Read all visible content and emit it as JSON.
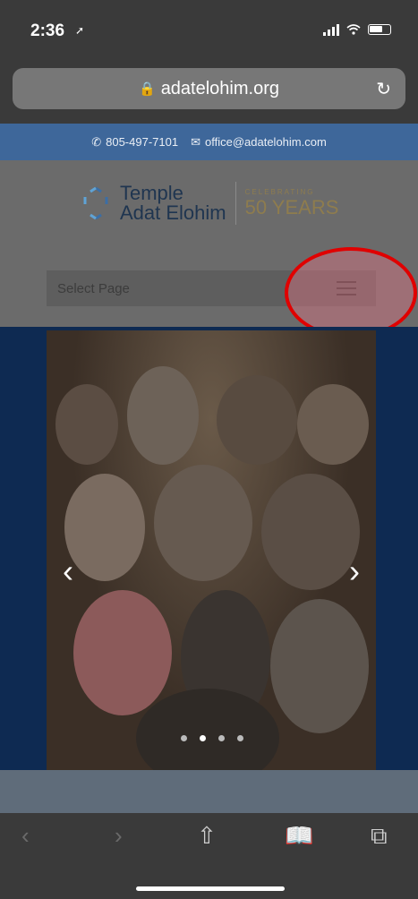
{
  "status": {
    "time": "2:36"
  },
  "browser": {
    "url": "adatelohim.org"
  },
  "contact": {
    "phone": "805-497-7101",
    "email": "office@adatelohim.com"
  },
  "logo": {
    "line1": "Temple",
    "line2": "Adat Elohim",
    "celebrating": "CELEBRATING",
    "years": "50 YEARS"
  },
  "nav": {
    "select_label": "Select Page"
  },
  "slider": {
    "slide_count": 4,
    "active_slide": 2
  },
  "colors": {
    "contact_bar": "#3e679a",
    "hero_bg": "#0e2a52",
    "highlight": "#e00000"
  }
}
